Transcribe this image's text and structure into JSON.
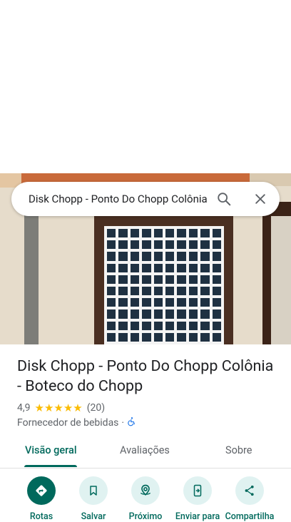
{
  "search": {
    "query": "Disk Chopp - Ponto Do Chopp Colônia - Boteco do Chopp"
  },
  "place": {
    "title": "Disk Chopp - Ponto Do Chopp Colônia - Boteco do Chopp",
    "rating": "4,9",
    "stars": "★★★★★",
    "review_count": "(20)",
    "category": "Fornecedor de bebidas",
    "separator": "·"
  },
  "tabs": [
    {
      "label": "Visão geral",
      "active": true
    },
    {
      "label": "Avaliações",
      "active": false
    },
    {
      "label": "Sobre",
      "active": false
    }
  ],
  "actions": [
    {
      "label": "Rotas",
      "icon": "directions-icon"
    },
    {
      "label": "Salvar",
      "icon": "bookmark-icon"
    },
    {
      "label": "Próximo",
      "icon": "nearby-icon"
    },
    {
      "label": "Enviar para",
      "icon": "send-to-phone-icon"
    },
    {
      "label": "Compartilha",
      "icon": "share-icon"
    }
  ],
  "colors": {
    "accent": "#00695c",
    "accent_light": "#e0f2f1",
    "star": "#fbbc04",
    "accessibility": "#1a73e8"
  }
}
